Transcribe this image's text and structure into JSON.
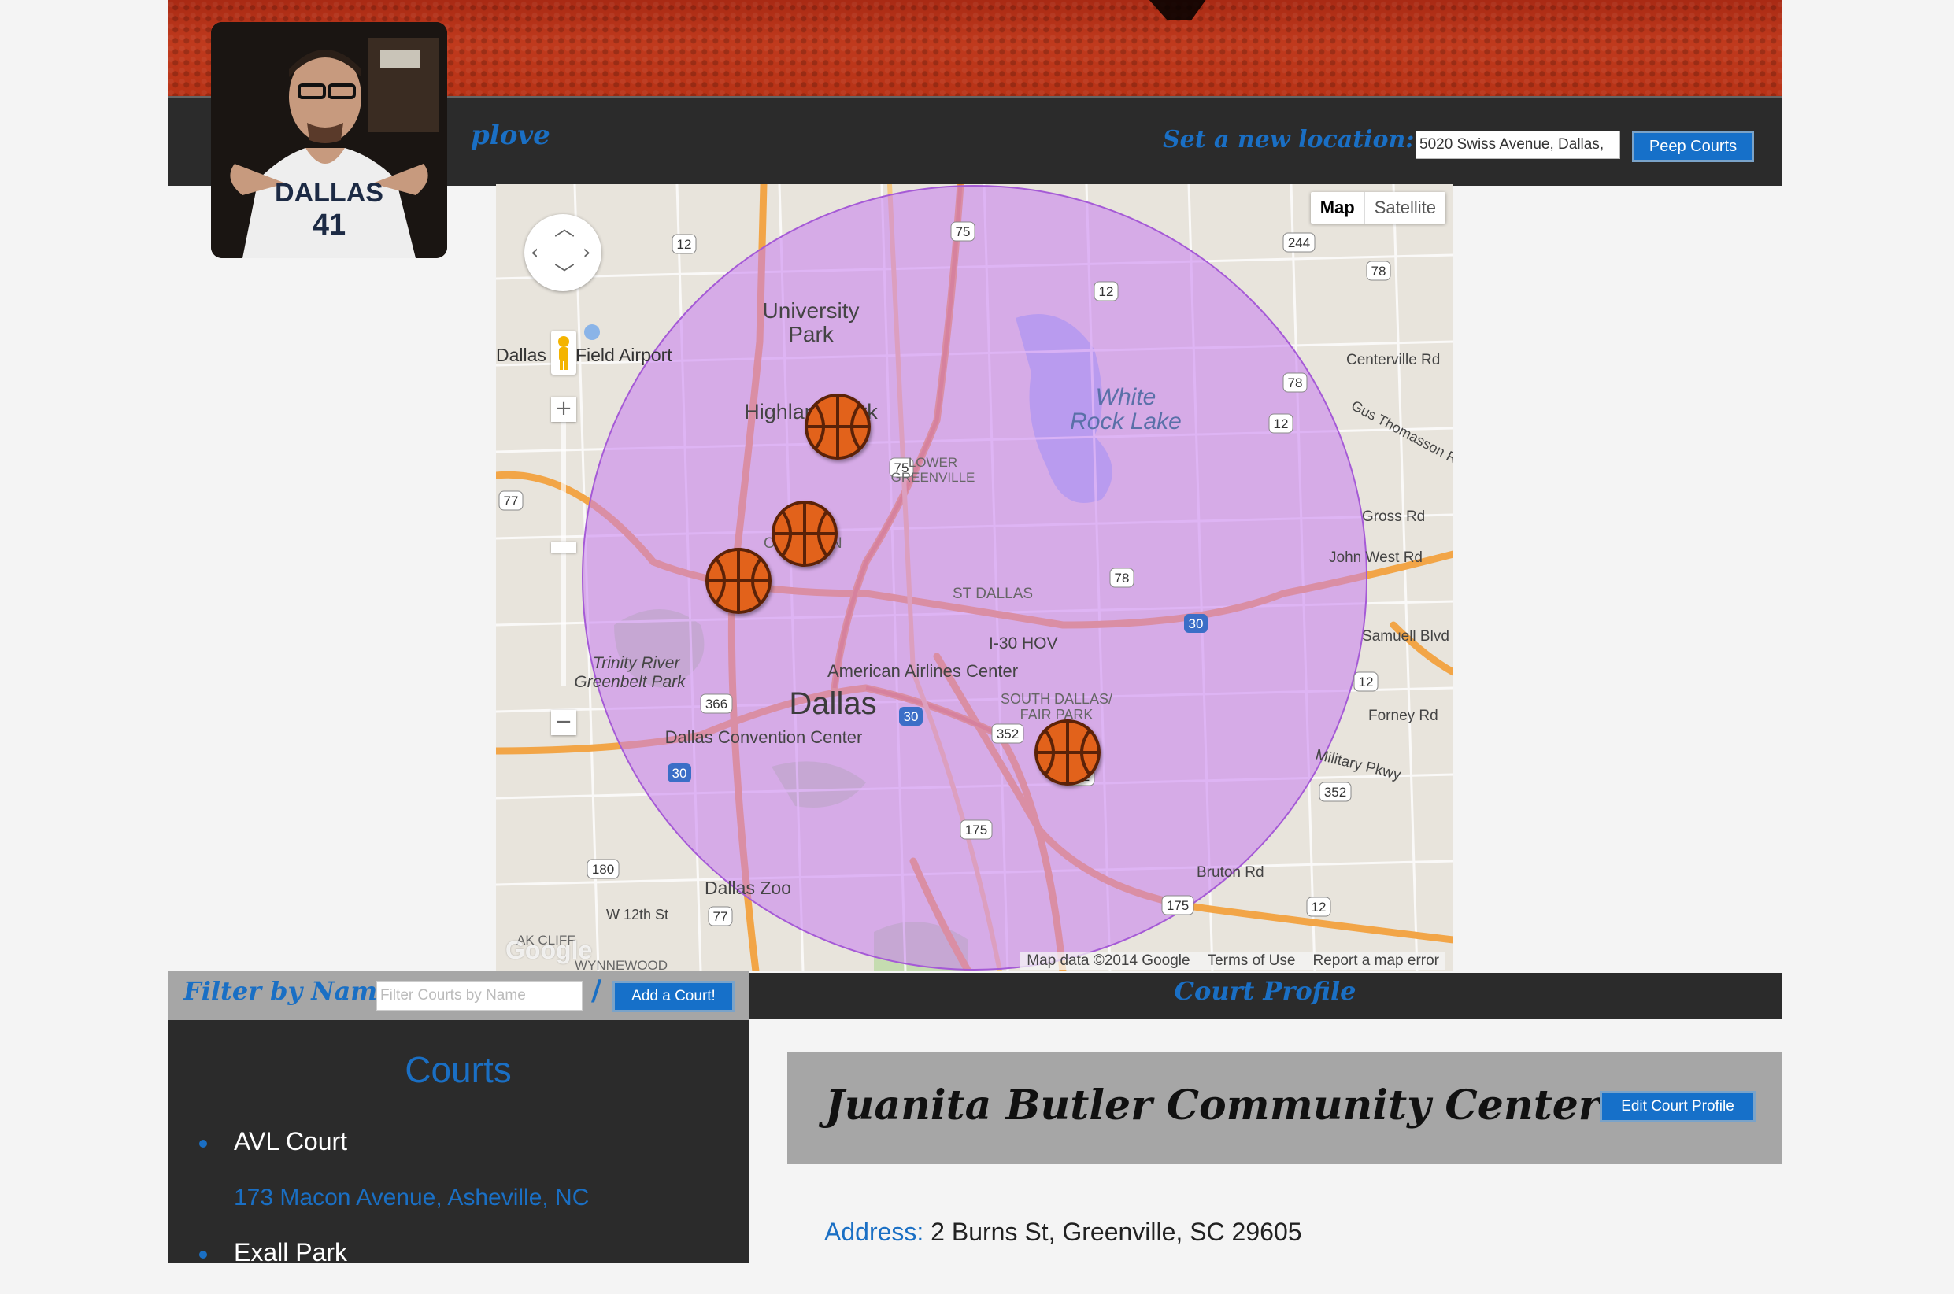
{
  "header": {
    "username": "plove",
    "location_label": "Set a new location:",
    "location_value": "5020 Swiss Avenue, Dallas,",
    "peep_button": "Peep Courts"
  },
  "map": {
    "type_controls": {
      "map": "Map",
      "satellite": "Satellite"
    },
    "labels": {
      "university_park": "University\nPark",
      "highland_park": "Highland Park",
      "lower_greenville": "LOWER\nGREENVILLE",
      "white_rock_lake": "White\nRock Lake",
      "oak_lawn": "OAK LAWN",
      "east_dallas": "ST DALLAS",
      "dallas": "Dallas",
      "american_airlines_center": "American Airlines Center",
      "dallas_convention_center": "Dallas Convention Center",
      "trinity_river": "Trinity River\nGreenbelt Park",
      "south_dallas": "SOUTH DALLAS/\nFAIR PARK",
      "dallas_zoo": "Dallas Zoo",
      "love_field": "Dallas  ve Field Airport",
      "i30_hov": "I-30 HOV",
      "centerville_rd": "Centerville Rd",
      "gus_thomasson": "Gus Thomasson R",
      "gross_rd": "Gross Rd",
      "john_west_rd": "John West Rd",
      "samuell_blvd": "Samuell Blvd",
      "forney_rd": "Forney Rd",
      "military_pkwy": "Military Pkwy",
      "bruton_rd": "Bruton Rd",
      "wynnewood": "WYNNEWOOD",
      "oak_cliff": "AK CLIFF",
      "w_12th_st": "W 12th St"
    },
    "highways": [
      "12",
      "75",
      "244",
      "78",
      "12",
      "78",
      "12",
      "77",
      "75",
      "78",
      "30",
      "12",
      "77",
      "366",
      "30",
      "352",
      "352",
      "30",
      "175",
      "352",
      "180",
      "77",
      "175",
      "12"
    ],
    "attribution": "Map data ©2014 Google",
    "terms": "Terms of Use",
    "report": "Report a map error",
    "google_logo": "Google"
  },
  "filter": {
    "label": "Filter by Name",
    "placeholder": "Filter Courts by Name",
    "separator": "/",
    "add_button": "Add a Court!"
  },
  "courts": {
    "title": "Courts",
    "items": [
      {
        "name": "AVL Court",
        "address": "173 Macon Avenue, Asheville, NC"
      },
      {
        "name": "Exall Park",
        "address": ""
      }
    ]
  },
  "profile": {
    "bar_title": "Court Profile",
    "name": "Juanita Butler Community Center",
    "edit_button": "Edit Court Profile",
    "address_label": "Address:",
    "address_value": "2 Burns St, Greenville, SC 29605"
  },
  "colors": {
    "accent": "#1a6fc4",
    "dark_bar": "#2b2b2b",
    "gray_panel": "#a6a6a6",
    "radius_fill": "#c77bf0"
  }
}
